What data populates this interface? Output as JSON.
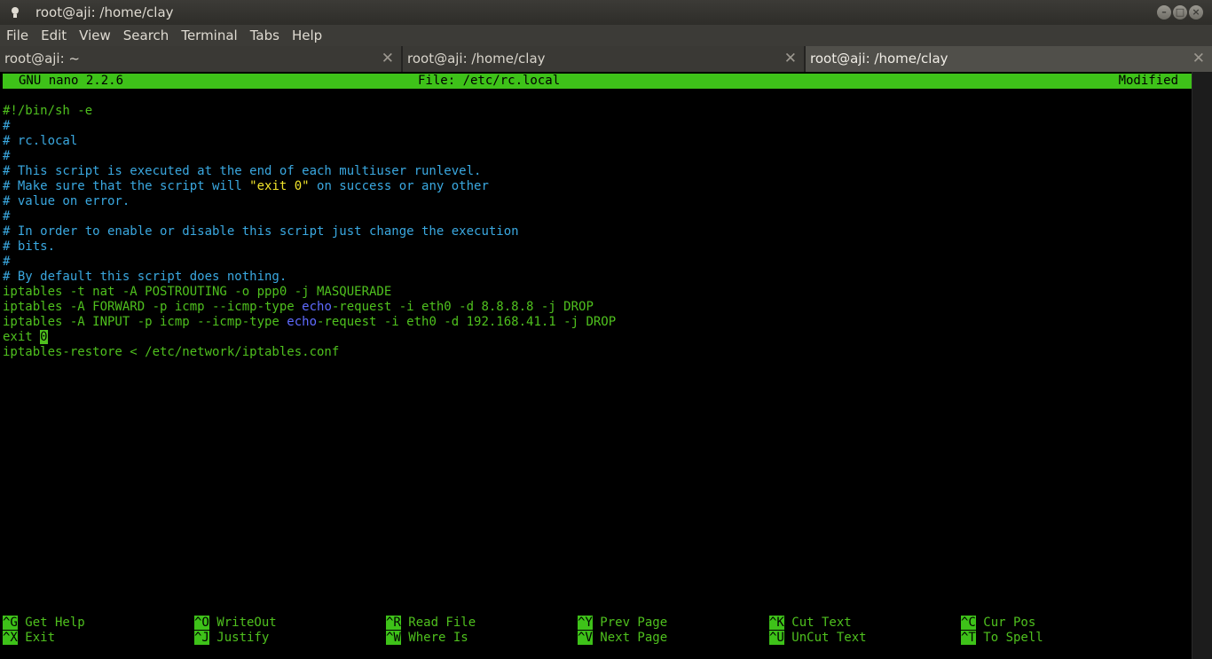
{
  "window": {
    "title": "root@aji: /home/clay"
  },
  "menu": [
    "File",
    "Edit",
    "View",
    "Search",
    "Terminal",
    "Tabs",
    "Help"
  ],
  "tabs": [
    {
      "label": "root@aji: ~",
      "active": false
    },
    {
      "label": "root@aji: /home/clay",
      "active": false
    },
    {
      "label": "root@aji: /home/clay",
      "active": true
    }
  ],
  "nano": {
    "version": "GNU nano 2.2.6",
    "file": "File: /etc/rc.local",
    "status": "Modified"
  },
  "lines": [
    "#!/bin/sh -e",
    "#",
    "# rc.local",
    "#",
    "# This script is executed at the end of each multiuser runlevel.",
    "# Make sure that the script will \"exit 0\" on success or any other",
    "# value on error.",
    "#",
    "# In order to enable or disable this script just change the execution",
    "# bits.",
    "#",
    "# By default this script does nothing.",
    "iptables -t nat -A POSTROUTING -o ppp0 -j MASQUERADE",
    "iptables -A FORWARD -p icmp --icmp-type echo-request -i eth0 -d 8.8.8.8 -j DROP",
    "iptables -A INPUT -p icmp --icmp-type echo-request -i eth0 -d 192.168.41.1 -j DROP",
    "exit 0",
    "iptables-restore < /etc/network/iptables.conf"
  ],
  "shortcuts": [
    {
      "key": "^G",
      "label": "Get Help"
    },
    {
      "key": "^O",
      "label": "WriteOut"
    },
    {
      "key": "^R",
      "label": "Read File"
    },
    {
      "key": "^Y",
      "label": "Prev Page"
    },
    {
      "key": "^K",
      "label": "Cut Text"
    },
    {
      "key": "^C",
      "label": "Cur Pos"
    },
    {
      "key": "^X",
      "label": "Exit"
    },
    {
      "key": "^J",
      "label": "Justify"
    },
    {
      "key": "^W",
      "label": "Where Is"
    },
    {
      "key": "^V",
      "label": "Next Page"
    },
    {
      "key": "^U",
      "label": "UnCut Text"
    },
    {
      "key": "^T",
      "label": "To Spell"
    }
  ],
  "colors": {
    "text": "#4fc01e",
    "bar": "#3ec219",
    "comment": "#3aa8e0",
    "string": "#f2e52b",
    "keyword": "#5f6bff"
  }
}
